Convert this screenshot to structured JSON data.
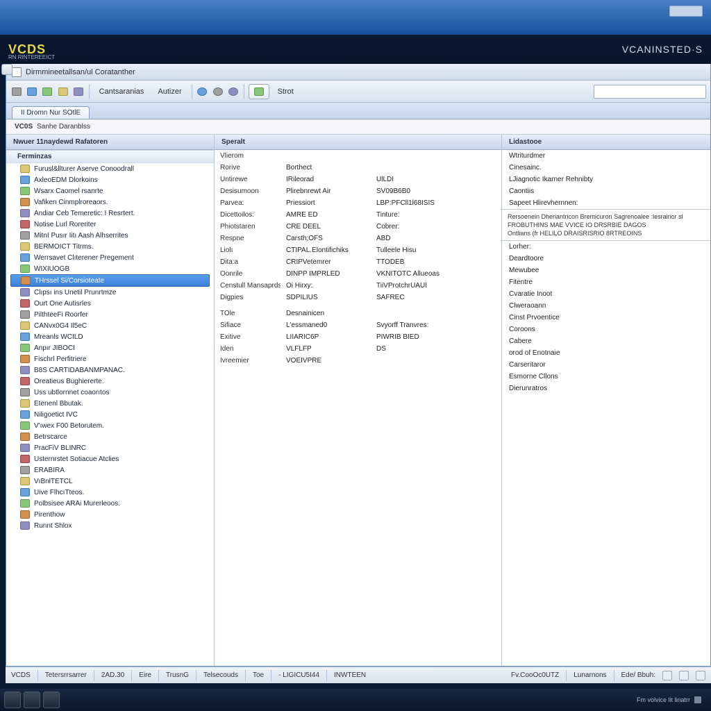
{
  "brand": {
    "name": "VCDS",
    "sub": "RN RINTEREEICT",
    "right": "VCANINSTED·S"
  },
  "titlebar": "Dirmmineetallsan/ul Coratanther",
  "toolbar": {
    "btn_config": "Cantsaranias",
    "btn_auth": "Autizer",
    "btn_start": "Strot"
  },
  "tab_active": "II Dromn Nur SOtlE",
  "subheader": {
    "left": "VC0S",
    "right": "Sanhe Daranblss"
  },
  "left": {
    "header": "Nwuer 11naydewd Rafatoren",
    "section": "Ferminzas",
    "items": [
      "Furusl&llturer Aserve Conoodrall",
      "AxleoEDM Dlorkoins",
      "Wsarx Caomel rsanrte",
      "Vafiken Cinmplroreaors.",
      "Andiar Ceb Temeretic: I Resrtert.",
      "Notise Lurl Roreriter",
      "MitnI Pusır Iitı Aash Alhserrites",
      "BERMOICT Titrms.",
      "Werrsavet Clıterener Pregement",
      "WIXIUOGB",
      "THrssel Si/Corsioteate",
      "Clıpsı ins Unetil Prunrtmze",
      "Ourt One Autisrles",
      "PilthteeFi Roorfer",
      "CANvx0G4 Il5eC",
      "Mreanls WCILD",
      "Anpır JIBOCI",
      "Fischrl Perfitriere",
      "B8S CARTIDABANMPANAC.",
      "Oreatieus Bughiererte.",
      "Uss ubtlornnet coaorıtos",
      "Etenenl Bbutak.",
      "Niligoetict IVC",
      "V'ıwex F00 Betorutem.",
      "Betrscarce",
      "PracFiV BLINRC",
      "Usternrstet Sotiacue Atclies",
      "ERABIRA",
      "VıBnłTETCL",
      "Uive FlhcıTteos.",
      "Polbsisee ARAi Murerleoos.",
      "Pirenthow",
      "Runnt Shlox"
    ],
    "selected_index": 10
  },
  "mid": {
    "header": "Speralt",
    "rows": [
      [
        "Vlierom",
        "",
        ""
      ],
      [
        "Rorive",
        "Borthect",
        ""
      ],
      [
        "Untirewe",
        "IRileorad",
        "UlLDI"
      ],
      [
        "Desisumoon",
        "Plirebnrewt Air",
        "SV09B6B0"
      ],
      [
        "Parvea:",
        "Priessiort",
        "LBP:PFCll1l68ISIS"
      ],
      [
        "Dicettoilos:",
        "AMRE ED",
        "Tinture:"
      ],
      [
        "Phiotstaren",
        "CRE DEEL",
        "Cobrer:"
      ],
      [
        "Respne",
        "Carsth;OFS",
        "ABD"
      ],
      [
        "Liolı",
        "CTIPAL.Elontifichiks",
        "Tulleele Hisu"
      ],
      [
        "Dita:a",
        "CRIPVetemrer",
        "TTODEB"
      ],
      [
        "Oonrile",
        "DINPP IMPRLED",
        "VKNITOTC Allueoas"
      ],
      [
        "Censtull Mansaprds",
        "Oi Hirxy:",
        "TiiVProtchrUAUI"
      ],
      [
        "Digpies",
        "SDPILIUS",
        "SAFREC"
      ],
      [
        "",
        "",
        ""
      ],
      [
        "TOle",
        "Desnainicen",
        ""
      ],
      [
        "Sifiace",
        "L'essmaned0",
        "Svyorff Tranvres:"
      ],
      [
        "Exitive",
        "LIIARIC6P",
        "PIWRIB BIED"
      ],
      [
        "Iden",
        "VLFLFP",
        "DS"
      ],
      [
        "Ivreemier",
        "VOEIVPRE",
        ""
      ]
    ]
  },
  "right": {
    "header": "Lidastooe",
    "initial": [
      "Wtriturdmer",
      "Cinesainc.",
      "LJiagnotic Ikarner Rehnibty",
      "Caontiis",
      "Sapeet Hlirevhernnen:"
    ],
    "desc": [
      "Rersoenein Dheriantricon Bremicuron Sagrenoalee :lesrairior sl",
      "FROBUTHINS MAE VVICE IO DRSRBIE DAGOS",
      "Ontlians (fr HELILO DRAISRISRIO 8RTREOINS"
    ],
    "rest": [
      "Lorher:",
      "Deardtoore",
      "Mewubee",
      "Fitentre",
      "Cvaratie Inoot",
      "Clweraoann",
      "Cinst Prvoentice",
      "Coroons",
      "Cabere",
      "orod of Enotnaie",
      "Carseritaror",
      "Esmorne Cllons",
      "Dierunratros"
    ]
  },
  "statusbar": {
    "items": [
      "VCDS",
      "Tetersrrsarrer",
      "2AD.30",
      "Eire",
      "TrusnG",
      "Telsecouds",
      "Toe",
      "- LIGICU5I44",
      "INWTEEN"
    ],
    "right": [
      "Fv.CooOc0UTZ",
      "Lunarnons",
      "Ede/ Bbuh:"
    ]
  },
  "taskbar": {
    "right_text": "Fm volvice lit linatrr"
  }
}
